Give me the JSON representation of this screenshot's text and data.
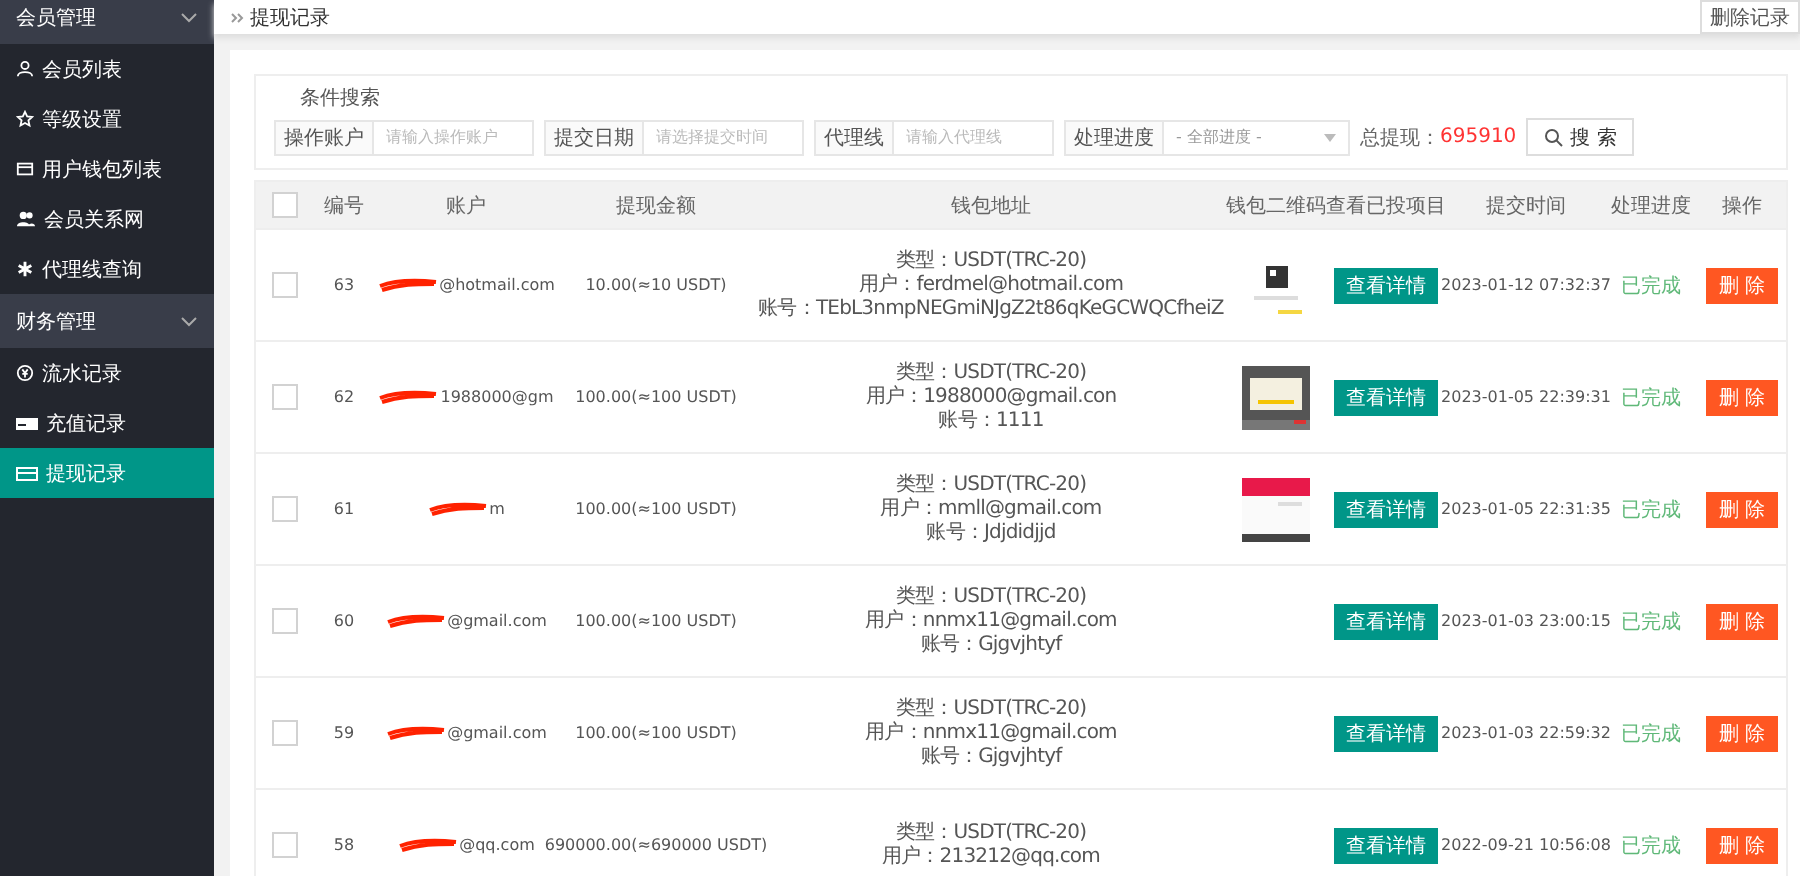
{
  "sidebar": {
    "groups": [
      {
        "label": "会员管理",
        "expanded": true,
        "items": [
          {
            "label": "会员列表",
            "selected": false
          },
          {
            "label": "等级设置",
            "selected": false
          },
          {
            "label": "用户钱包列表",
            "selected": false
          },
          {
            "label": "会员关系网",
            "selected": false
          },
          {
            "label": "代理线查询",
            "selected": false
          }
        ]
      },
      {
        "label": "财务管理",
        "expanded": true,
        "items": [
          {
            "label": "流水记录",
            "selected": false
          },
          {
            "label": "充值记录",
            "selected": false
          },
          {
            "label": "提现记录",
            "selected": true
          }
        ]
      }
    ]
  },
  "breadcrumb": "提现记录",
  "header_button": "删除记录",
  "search": {
    "legend": "条件搜索",
    "fields": [
      {
        "kind": "text",
        "label": "操作账户",
        "placeholder": "请输入操作账户"
      },
      {
        "kind": "text",
        "label": "提交日期",
        "placeholder": "请选择提交时间"
      },
      {
        "kind": "text",
        "label": "代理线",
        "placeholder": "请输入代理线"
      },
      {
        "kind": "select",
        "label": "处理进度",
        "value": "- 全部进度 -"
      }
    ],
    "total_label": "总提现：",
    "total_value": "695910",
    "button": "搜 索"
  },
  "table": {
    "header_checked": false,
    "columns": [
      "编号",
      "账户",
      "提现金额",
      "钱包地址",
      "钱包二维码",
      "查看已投项目",
      "提交时间",
      "处理进度",
      "操作"
    ],
    "rows": [
      {
        "checked": false,
        "id": "63",
        "account": "@hotmail.com",
        "amount": "10.00(≈10 USDT)",
        "wallet": [
          "类型：USDT(TRC-20)",
          "用户：ferdmel@hotmail.com",
          "账号：TEbL3nmpNEGmiNJgZ2t86qKeGCWQCfheiZ"
        ],
        "qr_code": {
          "kind": "picture"
        },
        "view": "查看详情",
        "time": "2023-01-12 07:32:37",
        "status": "已完成",
        "action": "删 除"
      },
      {
        "checked": false,
        "id": "62",
        "account": "1988000@gm",
        "amount": "100.00(≈100 USDT)",
        "wallet": [
          "类型：USDT(TRC-20)",
          "用户：1988000@gmail.con",
          "账号：1111"
        ],
        "qr_code": {
          "kind": "picture"
        },
        "view": "查看详情",
        "time": "2023-01-05 22:39:31",
        "status": "已完成",
        "action": "删 除"
      },
      {
        "checked": false,
        "id": "61",
        "account": "m",
        "amount": "100.00(≈100 USDT)",
        "wallet": [
          "类型：USDT(TRC-20)",
          "用户：mmll@gmail.com",
          "账号：Jdjdidjjd"
        ],
        "qr_code": {
          "kind": "picture"
        },
        "view": "查看详情",
        "time": "2023-01-05 22:31:35",
        "status": "已完成",
        "action": "删 除"
      },
      {
        "checked": false,
        "id": "60",
        "account": "@gmail.com",
        "amount": "100.00(≈100 USDT)",
        "wallet": [
          "类型：USDT(TRC-20)",
          "用户：nnmx11@gmail.com",
          "账号：Gjgvjhtyf"
        ],
        "view": "查看详情",
        "time": "2023-01-03 23:00:15",
        "status": "已完成",
        "action": "删 除"
      },
      {
        "checked": false,
        "id": "59",
        "account": "@gmail.com",
        "amount": "100.00(≈100 USDT)",
        "wallet": [
          "类型：USDT(TRC-20)",
          "用户：nnmx11@gmail.com",
          "账号：Gjgvjhtyf"
        ],
        "view": "查看详情",
        "time": "2023-01-03 22:59:32",
        "status": "已完成",
        "action": "删 除"
      },
      {
        "checked": false,
        "id": "58",
        "account": "@qq.com",
        "amount": "690000.00(≈690000 USDT)",
        "wallet": [
          "类型：USDT(TRC-20)",
          "用户：213212@qq.com"
        ],
        "view": "查看详情",
        "time": "2022-09-21 10:56:08",
        "status": "已完成",
        "action": "删 除"
      }
    ]
  }
}
